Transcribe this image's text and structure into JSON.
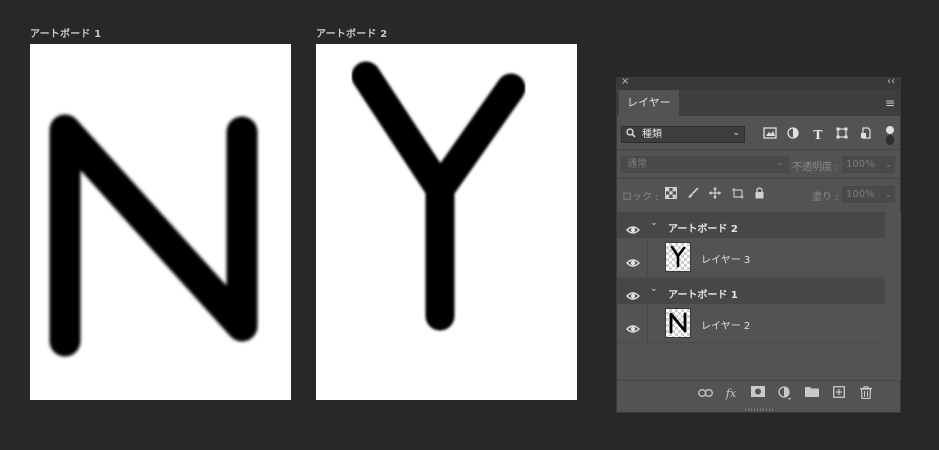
{
  "artboards": [
    {
      "label": "アートボード 1",
      "letter": "N"
    },
    {
      "label": "アートボード 2",
      "letter": "Y"
    }
  ],
  "panel": {
    "close_glyph": "×",
    "collapse_glyph": "‹‹",
    "tab_label": "レイヤー",
    "menu_glyph": "≡",
    "filter": {
      "value": "種類",
      "chevron": "⌄"
    },
    "blend": {
      "value": "通常",
      "opacity_label": "不透明度 :",
      "opacity_value": "100%",
      "fill_label": "塗り :",
      "fill_value": "100%"
    },
    "lock_label": "ロック :",
    "layers": [
      {
        "type": "group",
        "name": "アートボード 2"
      },
      {
        "type": "layer",
        "name": "レイヤー 3",
        "thumb": "Y"
      },
      {
        "type": "group",
        "name": "アートボード 1"
      },
      {
        "type": "layer",
        "name": "レイヤー 2",
        "thumb": "N"
      }
    ],
    "bottom_icons": [
      "link-icon",
      "fx-icon",
      "mask-icon",
      "adjustment-icon",
      "folder-icon",
      "new-layer-icon",
      "trash-icon"
    ],
    "fx_text": "fx"
  },
  "colors": {
    "background": "#282828",
    "panel": "#535353",
    "artboard": "#ffffff"
  }
}
